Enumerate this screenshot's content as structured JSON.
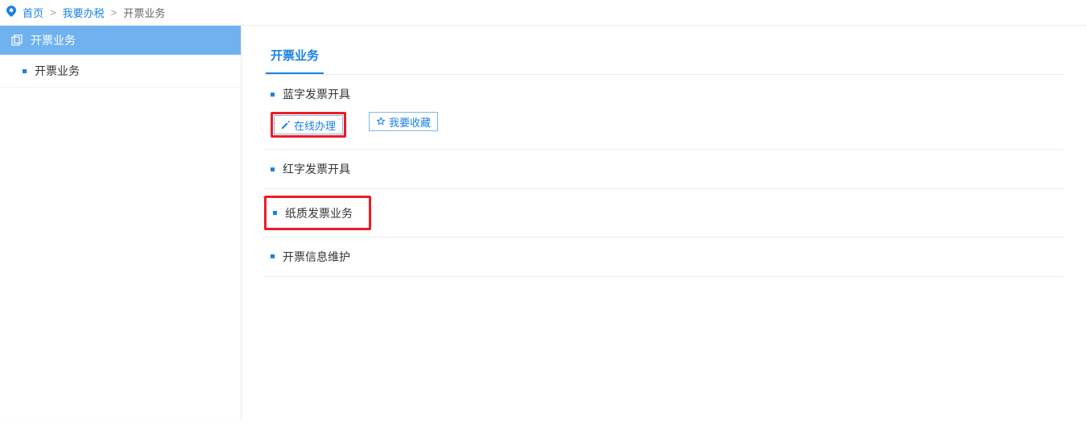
{
  "breadcrumb": {
    "home": "首页",
    "tax": "我要办税",
    "current": "开票业务"
  },
  "sidebar": {
    "header": "开票业务",
    "items": [
      {
        "label": "开票业务"
      }
    ]
  },
  "main": {
    "title": "开票业务",
    "actions": {
      "online": "在线办理",
      "favorite": "我要收藏"
    },
    "items": [
      {
        "label": "蓝字发票开具",
        "expanded": true
      },
      {
        "label": "红字发票开具"
      },
      {
        "label": "纸质发票业务",
        "highlighted": true
      },
      {
        "label": "开票信息维护"
      }
    ]
  }
}
